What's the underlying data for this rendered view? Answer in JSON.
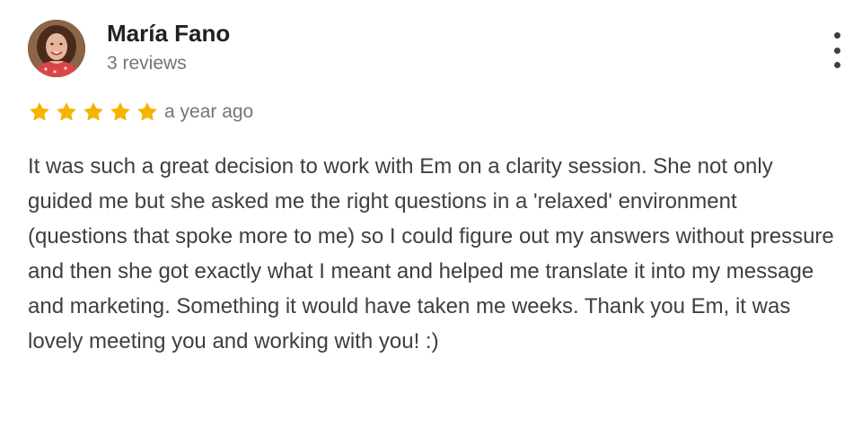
{
  "review": {
    "author_name": "María Fano",
    "author_reviews": "3 reviews",
    "rating": 5,
    "max_rating": 5,
    "time_ago": "a year ago",
    "text": "It was such a great decision to work with Em on a clarity session. She not only guided me but she asked me the right questions in a 'relaxed' environment (questions that spoke more to me) so I could figure out my answers without pressure and then she got exactly what I meant and helped me translate it into my message and marketing. Something it would have taken me weeks. Thank you Em, it was lovely meeting you and working with you! :)"
  },
  "icons": {
    "star": "star-icon",
    "menu": "more-vert-icon"
  },
  "colors": {
    "star": "#f4b400",
    "name": "#202124",
    "secondary": "#70757a",
    "body": "#3c4043"
  }
}
